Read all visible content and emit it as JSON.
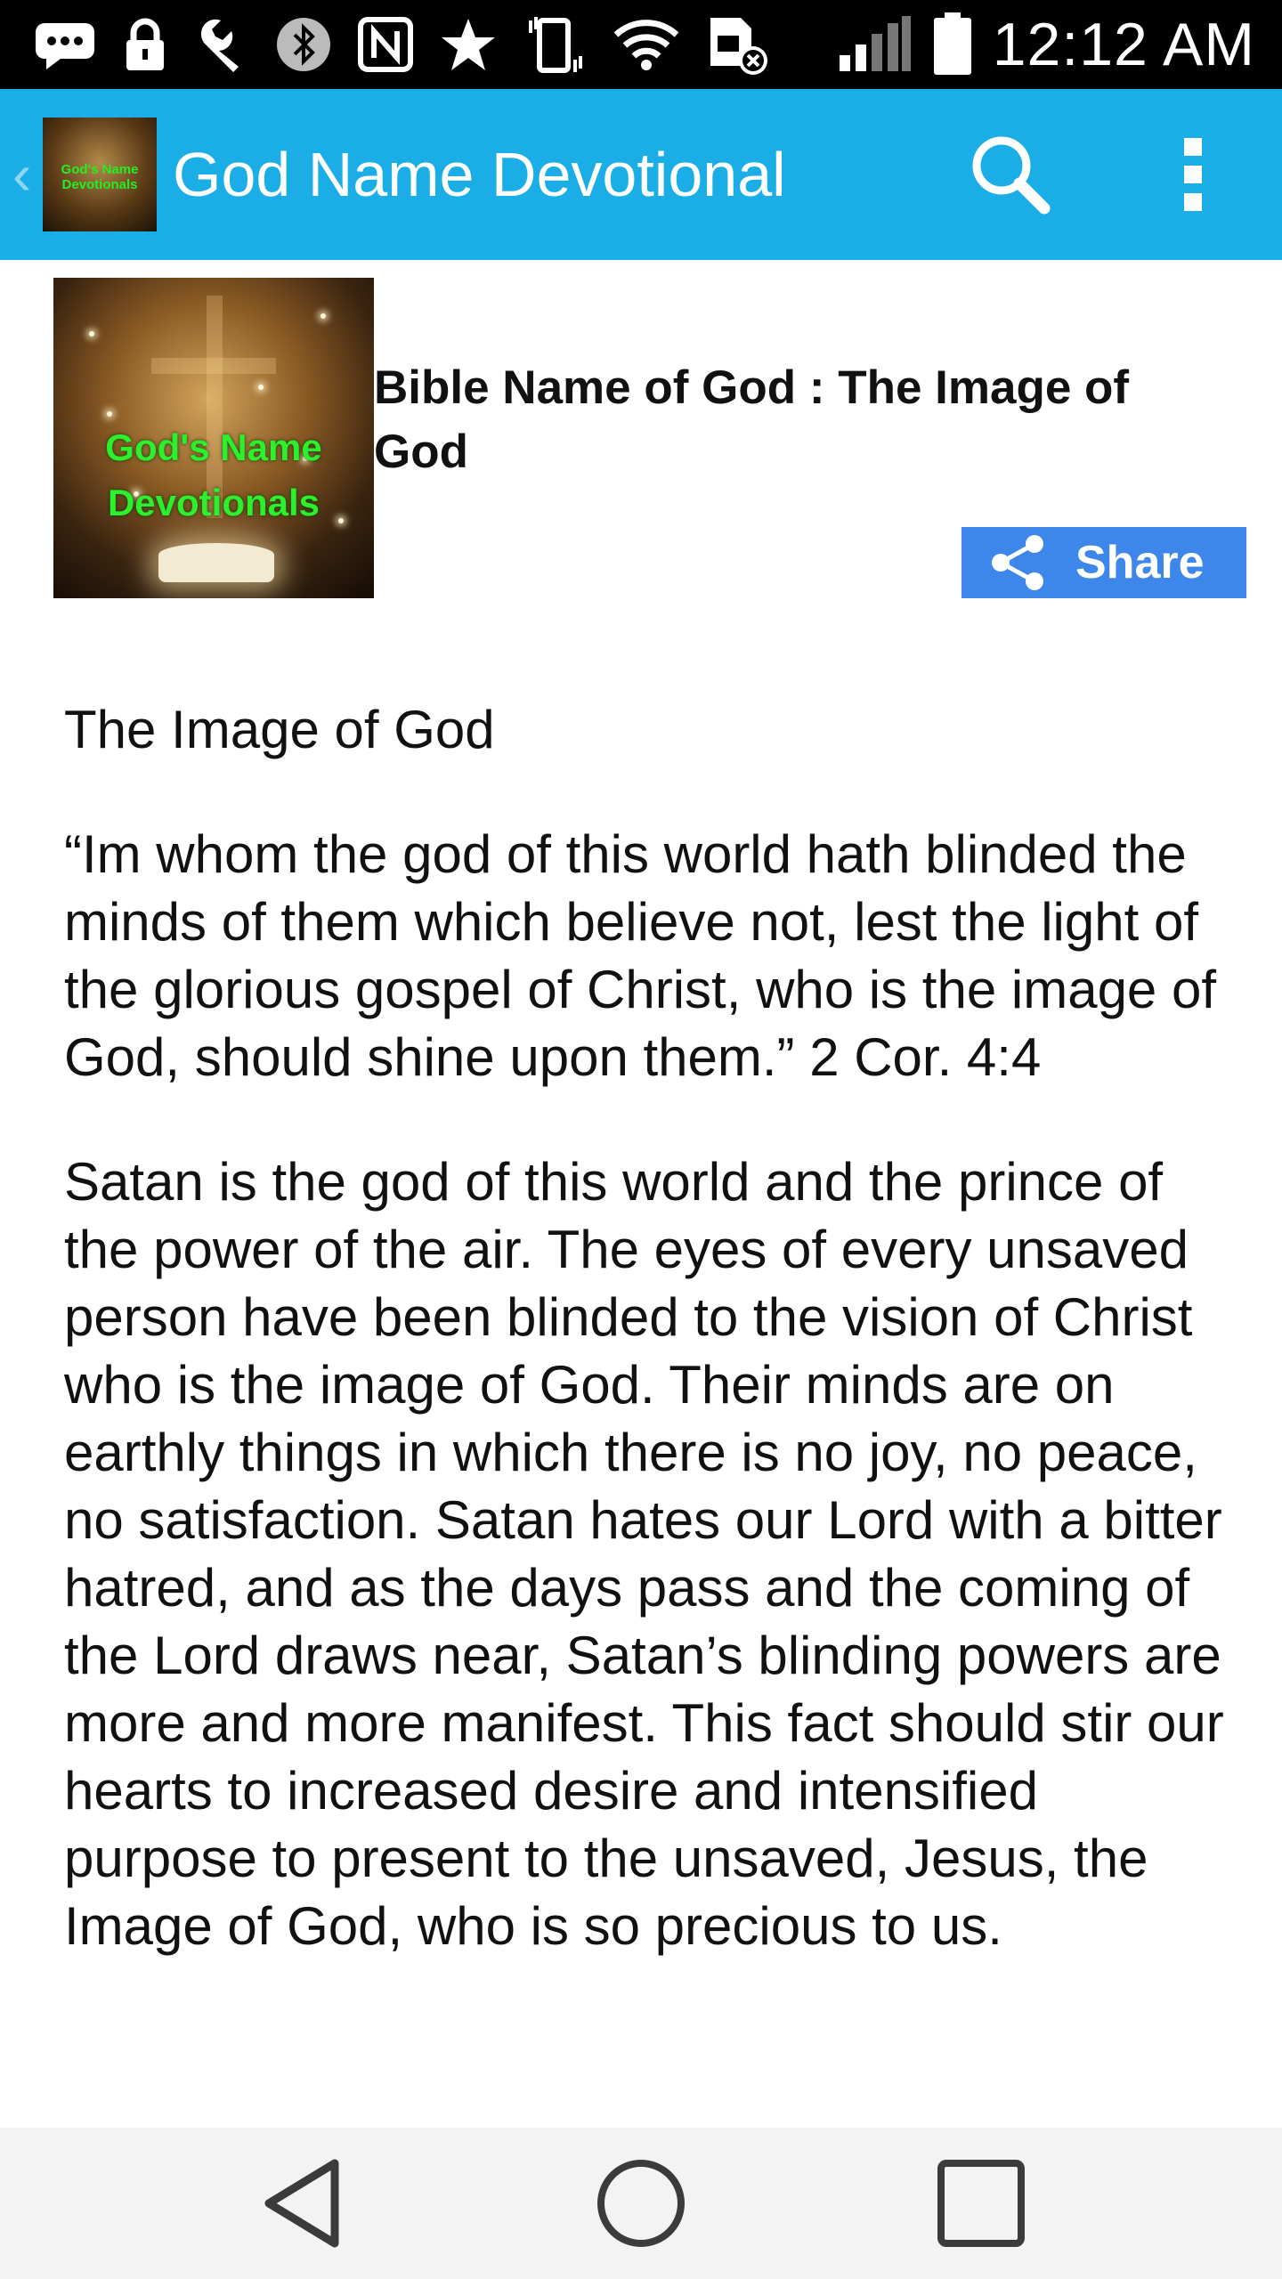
{
  "status_bar": {
    "time": "12:12 AM",
    "icons": [
      "message-icon",
      "lock-icon",
      "wrench-icon",
      "bluetooth-icon",
      "nfc-icon",
      "star-icon",
      "vibrate-icon",
      "wifi-icon",
      "sim-icon",
      "signal-icon",
      "battery-icon"
    ]
  },
  "app_bar": {
    "title": "God Name Devotional",
    "logo_text": "God's Name Devotionals",
    "back_icon": "chevron-left-icon",
    "search_icon": "search-icon",
    "overflow_icon": "more-vert-icon",
    "color": "#1baee6"
  },
  "article": {
    "image_text_line1": "God's Name",
    "image_text_line2": "Devotionals",
    "title": "Bible Name of God : The Image of God",
    "share_label": "Share",
    "share_color": "#3d86ea",
    "paragraphs": [
      "The Image of God",
      "“Im whom the god of this world hath blinded the minds of them which believe not, lest the light of the glorious gospel of Christ, who is the image of God, should shine upon them.” 2 Cor. 4:4",
      "Satan is the god of this world and the prince of the power of the air. The eyes of every unsaved person have been blinded to the vision of Christ who is the image of God. Their minds are on earthly things in which there is no joy, no peace, no satisfaction. Satan hates our Lord with a bitter hatred, and as the days pass and the coming of the Lord draws near, Satan’s blinding powers are more and more manifest. This fact should stir our hearts to increased desire and intensified purpose to present to the unsaved, Jesus, the Image of God, who is so precious to us."
    ]
  },
  "nav_bar": {
    "buttons": [
      "back-triangle-icon",
      "home-circle-icon",
      "recents-square-icon"
    ]
  }
}
